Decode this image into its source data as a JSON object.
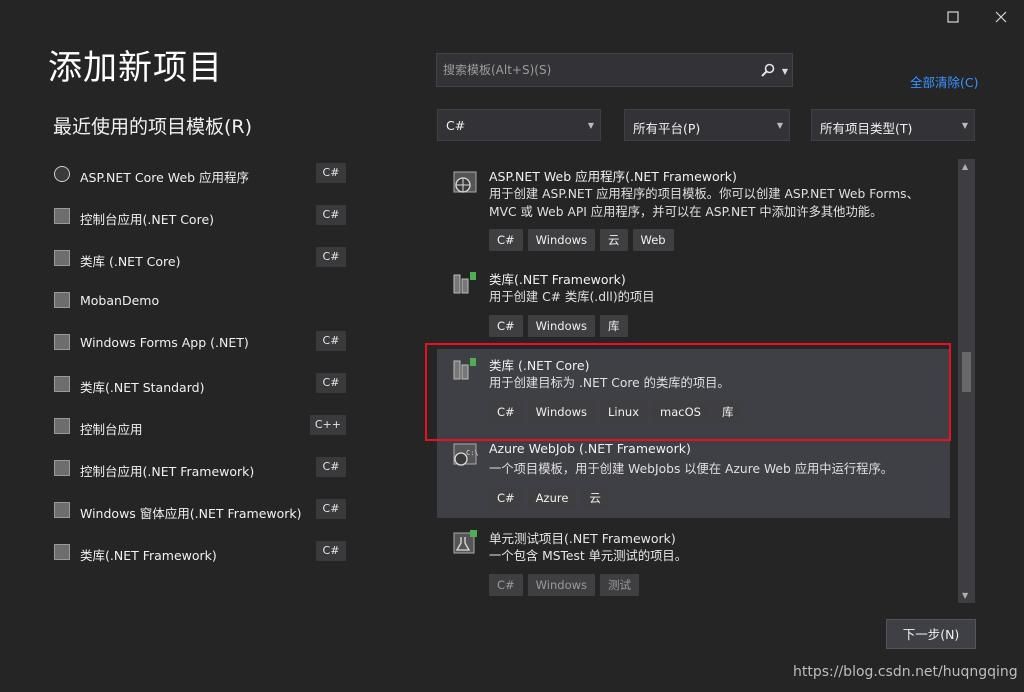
{
  "window": {
    "maximize_icon": "maximize-icon",
    "close_icon": "close-icon"
  },
  "header": {
    "title": "添加新项目"
  },
  "recent": {
    "title": "最近使用的项目模板(R)",
    "items": [
      {
        "label": "ASP.NET Core Web 应用程序",
        "lang": "C#",
        "icon": "globe-project-icon"
      },
      {
        "label": "控制台应用(.NET Core)",
        "lang": "C#",
        "icon": "console-app-icon"
      },
      {
        "label": "类库 (.NET Core)",
        "lang": "C#",
        "icon": "class-library-icon"
      },
      {
        "label": "MobanDemo",
        "lang": "",
        "icon": "custom-template-icon"
      },
      {
        "label": "Windows Forms App (.NET)",
        "lang": "C#",
        "icon": "windows-forms-icon"
      },
      {
        "label": "类库(.NET Standard)",
        "lang": "C#",
        "icon": "class-library-icon"
      },
      {
        "label": "控制台应用",
        "lang": "C++",
        "icon": "console-app-icon"
      },
      {
        "label": "控制台应用(.NET Framework)",
        "lang": "C#",
        "icon": "console-app-icon"
      },
      {
        "label": "Windows 窗体应用(.NET Framework)",
        "lang": "C#",
        "icon": "windows-forms-icon"
      },
      {
        "label": "类库(.NET Framework)",
        "lang": "C#",
        "icon": "class-library-icon"
      }
    ]
  },
  "search": {
    "placeholder": "搜索模板(Alt+S)(S)"
  },
  "clear_all": "全部清除(C)",
  "filters": {
    "language": "C#",
    "platform": "所有平台(P)",
    "type": "所有项目类型(T)"
  },
  "templates": [
    {
      "title": "ASP.NET Web 应用程序(.NET Framework)",
      "description": "用于创建 ASP.NET 应用程序的项目模板。你可以创建 ASP.NET Web Forms、MVC 或 Web API 应用程序，并可以在 ASP.NET 中添加许多其他功能。",
      "tags": [
        "C#",
        "Windows",
        "云",
        "Web"
      ]
    },
    {
      "title": "类库(.NET Framework)",
      "description": "用于创建 C# 类库(.dll)的项目",
      "tags": [
        "C#",
        "Windows",
        "库"
      ]
    },
    {
      "title": "类库 (.NET Core)",
      "description": "用于创建目标为 .NET Core 的类库的项目。",
      "tags": [
        "C#",
        "Windows",
        "Linux",
        "macOS",
        "库"
      ],
      "selected": true
    },
    {
      "title": "Azure WebJob (.NET Framework)",
      "description": "一个项目模板，用于创建 WebJobs 以便在 Azure Web 应用中运行程序。",
      "tags": [
        "C#",
        "Azure",
        "云"
      ]
    },
    {
      "title": "单元测试项目(.NET Framework)",
      "description": "一个包含 MSTest 单元测试的项目。",
      "tags": [
        "C#",
        "Windows",
        "测试"
      ]
    }
  ],
  "scroll_position": 0.45,
  "next_button": "下一步(N)",
  "watermark": "https://blog.csdn.net/huqngqing",
  "colors": {
    "background": "#252526",
    "accent_link": "#3794ff",
    "highlight_border": "#e81123",
    "hover_card": "#3f3f46"
  }
}
